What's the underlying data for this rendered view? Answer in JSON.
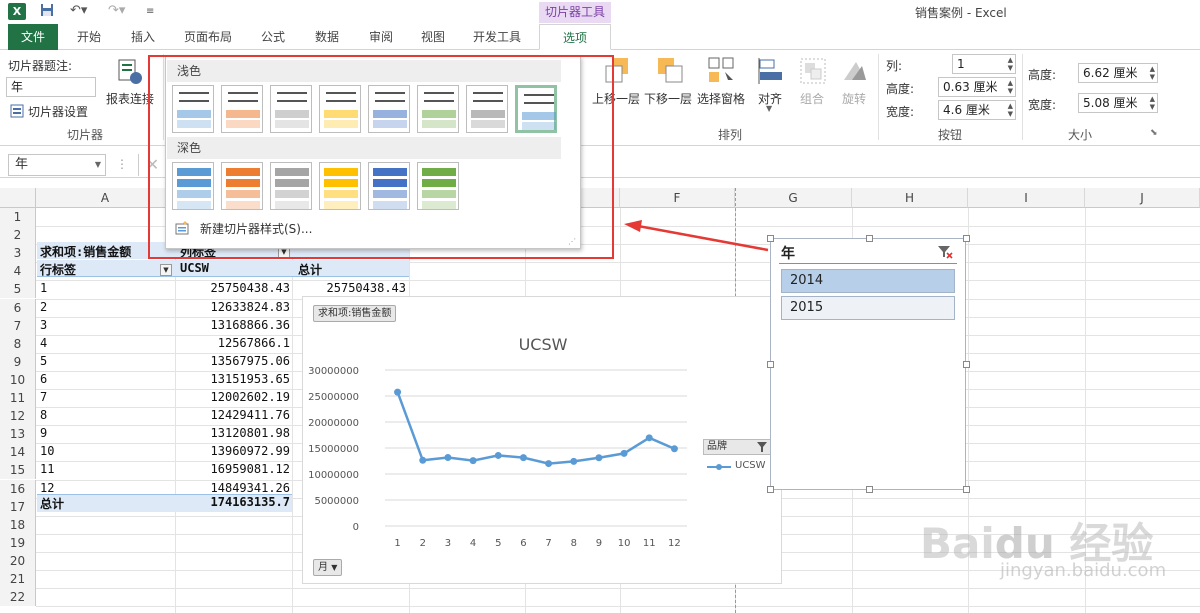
{
  "window": {
    "title": "销售案例 - Excel",
    "context_tab_group": "切片器工具"
  },
  "tabs": [
    "文件",
    "开始",
    "插入",
    "页面布局",
    "公式",
    "数据",
    "审阅",
    "视图",
    "开发工具",
    "选项"
  ],
  "ribbon": {
    "slicer_caption_label": "切片器题注:",
    "slicer_caption_value": "年",
    "slicer_settings": "切片器设置",
    "report_connections": "报表连接",
    "group_slicer": "切片器",
    "bring_forward": "上移一层",
    "send_backward": "下移一层",
    "selection_pane": "选择窗格",
    "align": "对齐",
    "group": "组合",
    "rotate": "旋转",
    "group_arrange": "排列",
    "columns_label": "列:",
    "columns_value": "1",
    "btn_height_label": "高度:",
    "btn_height_value": "0.63 厘米",
    "btn_width_label": "宽度:",
    "btn_width_value": "4.6 厘米",
    "group_buttons": "按钮",
    "size_height_label": "高度:",
    "size_height_value": "6.62 厘米",
    "size_width_label": "宽度:",
    "size_width_value": "5.08 厘米",
    "group_size": "大小"
  },
  "namebox": "年",
  "gallery": {
    "light_label": "浅色",
    "dark_label": "深色",
    "new_style": "新建切片器样式(S)...",
    "light_colors": [
      "#5b9bd5",
      "#ed7d31",
      "#a5a5a5",
      "#ffc000",
      "#4472c4",
      "#70ad47",
      "#808080",
      "#5b9bd5"
    ],
    "dark_colors": [
      "#5b9bd5",
      "#ed7d31",
      "#a5a5a5",
      "#ffc000",
      "#4472c4",
      "#70ad47"
    ]
  },
  "columns": [
    "A",
    "B",
    "C",
    "D",
    "E",
    "F",
    "G",
    "H",
    "I",
    "J"
  ],
  "rows": [
    "1",
    "2",
    "3",
    "4",
    "5",
    "6",
    "7",
    "8",
    "9",
    "10",
    "11",
    "12",
    "13",
    "14",
    "15",
    "16",
    "17",
    "18",
    "19",
    "20",
    "21",
    "22"
  ],
  "pivot": {
    "title_a": "求和项:销售金额",
    "title_b": "列标签",
    "row_label": "行标签",
    "col_ucsw": "UCSW",
    "col_total": "总计",
    "data_rows": [
      {
        "label": "1",
        "ucsw": "25750438.43",
        "total": "25750438.43"
      },
      {
        "label": "2",
        "ucsw": "12633824.83",
        "total": ""
      },
      {
        "label": "3",
        "ucsw": "13168866.36",
        "total": ""
      },
      {
        "label": "4",
        "ucsw": "12567866.1",
        "total": ""
      },
      {
        "label": "5",
        "ucsw": "13567975.06",
        "total": ""
      },
      {
        "label": "6",
        "ucsw": "13151953.65",
        "total": ""
      },
      {
        "label": "7",
        "ucsw": "12002602.19",
        "total": ""
      },
      {
        "label": "8",
        "ucsw": "12429411.76",
        "total": ""
      },
      {
        "label": "9",
        "ucsw": "13120801.98",
        "total": ""
      },
      {
        "label": "10",
        "ucsw": "13960972.99",
        "total": ""
      },
      {
        "label": "11",
        "ucsw": "16959081.12",
        "total": ""
      },
      {
        "label": "12",
        "ucsw": "14849341.26",
        "total": ""
      }
    ],
    "total_label": "总计",
    "total_value": "174163135.7"
  },
  "chart_data": {
    "type": "line",
    "title": "UCSW",
    "field_button": "求和项:销售金额",
    "axis_button": "月",
    "legend_field": "品牌",
    "legend_position": "right",
    "categories": [
      "1",
      "2",
      "3",
      "4",
      "5",
      "6",
      "7",
      "8",
      "9",
      "10",
      "11",
      "12"
    ],
    "series": [
      {
        "name": "UCSW",
        "color": "#5b9bd5",
        "values": [
          25750438.43,
          12633824.83,
          13168866.36,
          12567866.1,
          13567975.06,
          13151953.65,
          12002602.19,
          12429411.76,
          13120801.98,
          13960972.99,
          16959081.12,
          14849341.26
        ]
      }
    ],
    "ylim": [
      0,
      30000000
    ],
    "yticks": [
      "30000000",
      "25000000",
      "20000000",
      "15000000",
      "10000000",
      "5000000",
      "0"
    ],
    "grid": true
  },
  "slicer": {
    "header": "年",
    "items": [
      "2014",
      "2015"
    ]
  }
}
